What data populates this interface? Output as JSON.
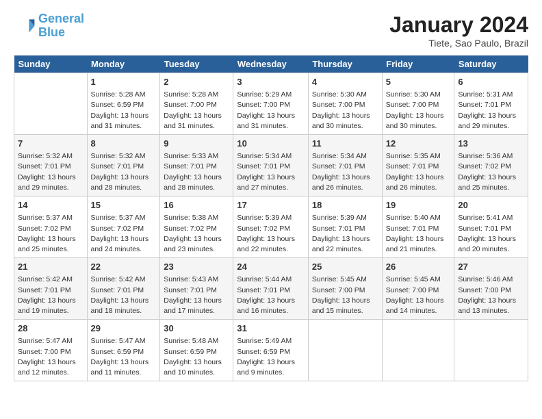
{
  "header": {
    "logo_general": "General",
    "logo_blue": "Blue",
    "title": "January 2024",
    "subtitle": "Tiete, Sao Paulo, Brazil"
  },
  "days_of_week": [
    "Sunday",
    "Monday",
    "Tuesday",
    "Wednesday",
    "Thursday",
    "Friday",
    "Saturday"
  ],
  "weeks": [
    [
      {
        "day": "",
        "info": ""
      },
      {
        "day": "1",
        "info": "Sunrise: 5:28 AM\nSunset: 6:59 PM\nDaylight: 13 hours\nand 31 minutes."
      },
      {
        "day": "2",
        "info": "Sunrise: 5:28 AM\nSunset: 7:00 PM\nDaylight: 13 hours\nand 31 minutes."
      },
      {
        "day": "3",
        "info": "Sunrise: 5:29 AM\nSunset: 7:00 PM\nDaylight: 13 hours\nand 31 minutes."
      },
      {
        "day": "4",
        "info": "Sunrise: 5:30 AM\nSunset: 7:00 PM\nDaylight: 13 hours\nand 30 minutes."
      },
      {
        "day": "5",
        "info": "Sunrise: 5:30 AM\nSunset: 7:00 PM\nDaylight: 13 hours\nand 30 minutes."
      },
      {
        "day": "6",
        "info": "Sunrise: 5:31 AM\nSunset: 7:01 PM\nDaylight: 13 hours\nand 29 minutes."
      }
    ],
    [
      {
        "day": "7",
        "info": "Sunrise: 5:32 AM\nSunset: 7:01 PM\nDaylight: 13 hours\nand 29 minutes."
      },
      {
        "day": "8",
        "info": "Sunrise: 5:32 AM\nSunset: 7:01 PM\nDaylight: 13 hours\nand 28 minutes."
      },
      {
        "day": "9",
        "info": "Sunrise: 5:33 AM\nSunset: 7:01 PM\nDaylight: 13 hours\nand 28 minutes."
      },
      {
        "day": "10",
        "info": "Sunrise: 5:34 AM\nSunset: 7:01 PM\nDaylight: 13 hours\nand 27 minutes."
      },
      {
        "day": "11",
        "info": "Sunrise: 5:34 AM\nSunset: 7:01 PM\nDaylight: 13 hours\nand 26 minutes."
      },
      {
        "day": "12",
        "info": "Sunrise: 5:35 AM\nSunset: 7:01 PM\nDaylight: 13 hours\nand 26 minutes."
      },
      {
        "day": "13",
        "info": "Sunrise: 5:36 AM\nSunset: 7:02 PM\nDaylight: 13 hours\nand 25 minutes."
      }
    ],
    [
      {
        "day": "14",
        "info": "Sunrise: 5:37 AM\nSunset: 7:02 PM\nDaylight: 13 hours\nand 25 minutes."
      },
      {
        "day": "15",
        "info": "Sunrise: 5:37 AM\nSunset: 7:02 PM\nDaylight: 13 hours\nand 24 minutes."
      },
      {
        "day": "16",
        "info": "Sunrise: 5:38 AM\nSunset: 7:02 PM\nDaylight: 13 hours\nand 23 minutes."
      },
      {
        "day": "17",
        "info": "Sunrise: 5:39 AM\nSunset: 7:02 PM\nDaylight: 13 hours\nand 22 minutes."
      },
      {
        "day": "18",
        "info": "Sunrise: 5:39 AM\nSunset: 7:01 PM\nDaylight: 13 hours\nand 22 minutes."
      },
      {
        "day": "19",
        "info": "Sunrise: 5:40 AM\nSunset: 7:01 PM\nDaylight: 13 hours\nand 21 minutes."
      },
      {
        "day": "20",
        "info": "Sunrise: 5:41 AM\nSunset: 7:01 PM\nDaylight: 13 hours\nand 20 minutes."
      }
    ],
    [
      {
        "day": "21",
        "info": "Sunrise: 5:42 AM\nSunset: 7:01 PM\nDaylight: 13 hours\nand 19 minutes."
      },
      {
        "day": "22",
        "info": "Sunrise: 5:42 AM\nSunset: 7:01 PM\nDaylight: 13 hours\nand 18 minutes."
      },
      {
        "day": "23",
        "info": "Sunrise: 5:43 AM\nSunset: 7:01 PM\nDaylight: 13 hours\nand 17 minutes."
      },
      {
        "day": "24",
        "info": "Sunrise: 5:44 AM\nSunset: 7:01 PM\nDaylight: 13 hours\nand 16 minutes."
      },
      {
        "day": "25",
        "info": "Sunrise: 5:45 AM\nSunset: 7:00 PM\nDaylight: 13 hours\nand 15 minutes."
      },
      {
        "day": "26",
        "info": "Sunrise: 5:45 AM\nSunset: 7:00 PM\nDaylight: 13 hours\nand 14 minutes."
      },
      {
        "day": "27",
        "info": "Sunrise: 5:46 AM\nSunset: 7:00 PM\nDaylight: 13 hours\nand 13 minutes."
      }
    ],
    [
      {
        "day": "28",
        "info": "Sunrise: 5:47 AM\nSunset: 7:00 PM\nDaylight: 13 hours\nand 12 minutes."
      },
      {
        "day": "29",
        "info": "Sunrise: 5:47 AM\nSunset: 6:59 PM\nDaylight: 13 hours\nand 11 minutes."
      },
      {
        "day": "30",
        "info": "Sunrise: 5:48 AM\nSunset: 6:59 PM\nDaylight: 13 hours\nand 10 minutes."
      },
      {
        "day": "31",
        "info": "Sunrise: 5:49 AM\nSunset: 6:59 PM\nDaylight: 13 hours\nand 9 minutes."
      },
      {
        "day": "",
        "info": ""
      },
      {
        "day": "",
        "info": ""
      },
      {
        "day": "",
        "info": ""
      }
    ]
  ]
}
